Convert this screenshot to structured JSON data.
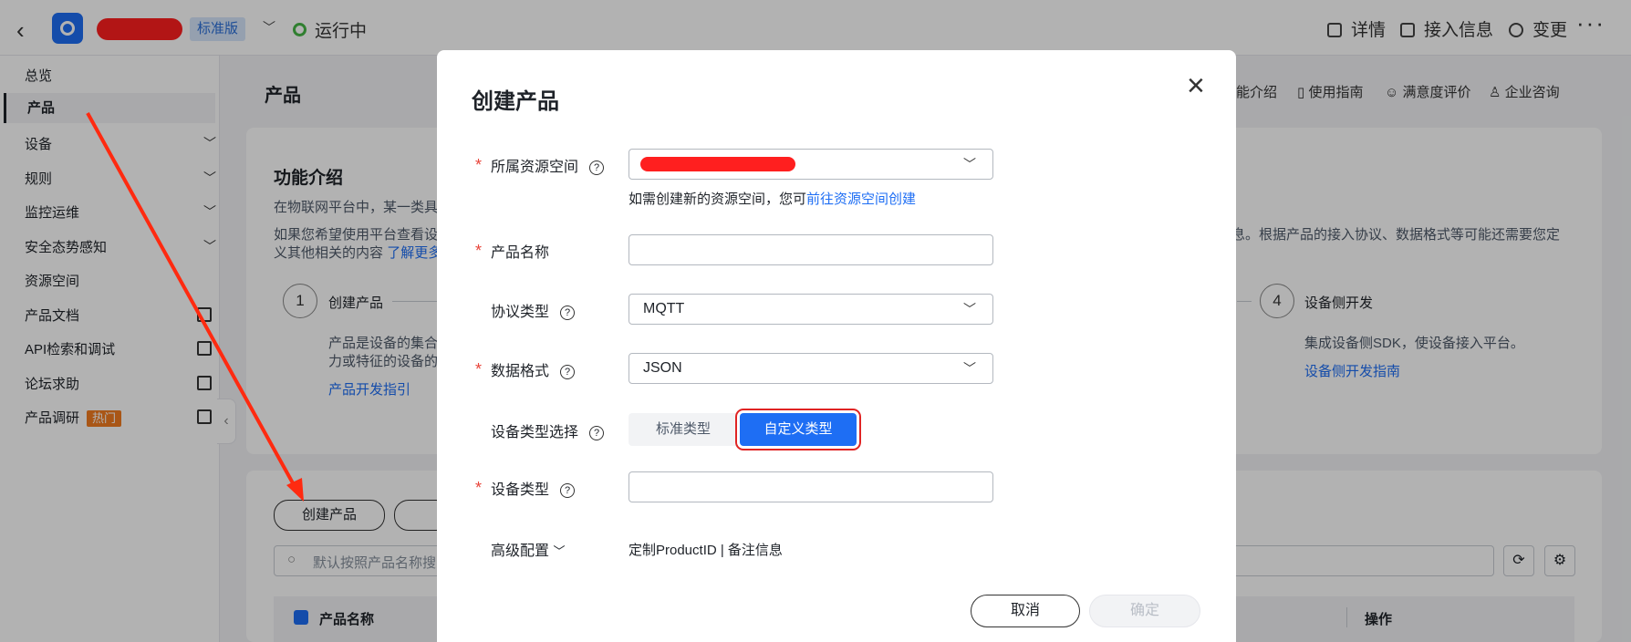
{
  "topbar": {
    "edition": "标准版",
    "status": "运行中",
    "links": [
      "详情",
      "接入信息",
      "变更"
    ],
    "more": "···"
  },
  "sidebar": {
    "items": [
      {
        "label": "总览"
      },
      {
        "label": "产品"
      },
      {
        "label": "设备"
      },
      {
        "label": "规则"
      },
      {
        "label": "监控运维"
      },
      {
        "label": "安全态势感知"
      },
      {
        "label": "资源空间"
      },
      {
        "label": "产品文档"
      },
      {
        "label": "API检索和调试"
      },
      {
        "label": "论坛求助"
      },
      {
        "label": "产品调研"
      }
    ],
    "hot_badge": "热门"
  },
  "main": {
    "title": "产品",
    "header_links": [
      "功能介绍",
      "使用指南",
      "满意度评价",
      "企业咨询"
    ],
    "intro_title": "功能介绍",
    "intro_line1": "在物联网平台中，某一类具",
    "intro_line2": "如果您希望使用平台查看设",
    "intro_line2_right": "息。根据产品的接入协议、数据格式等可能还需要您定",
    "intro_line3": "义其他相关的内容",
    "learn_more": "了解更多",
    "steps": [
      {
        "num": "1",
        "title": "创建产品",
        "desc1": "产品是设备的集合",
        "desc2": "力或特征的设备的",
        "link": "产品开发指引"
      },
      {
        "num": "4",
        "title": "设备侧开发",
        "desc1": "集成设备侧SDK，使设备接入平台。",
        "link": "设备侧开发指南"
      }
    ],
    "create_button": "创建产品",
    "search_placeholder": "默认按照产品名称搜",
    "table_headers": [
      "产品名称",
      "操作"
    ]
  },
  "modal": {
    "title": "创建产品",
    "close": "×",
    "fields": {
      "resource_space": {
        "label": "所属资源空间",
        "required": true
      },
      "resource_hint": "如需创建新的资源空间，您可",
      "resource_hint_link": "前往资源空间创建",
      "product_name": {
        "label": "产品名称",
        "required": true,
        "value": ""
      },
      "protocol": {
        "label": "协议类型",
        "value": "MQTT"
      },
      "data_format": {
        "label": "数据格式",
        "required": true,
        "value": "JSON"
      },
      "device_type_select": {
        "label": "设备类型选择",
        "options": [
          "标准类型",
          "自定义类型"
        ],
        "selected": "自定义类型"
      },
      "device_type": {
        "label": "设备类型",
        "required": true,
        "value": ""
      },
      "advanced": {
        "label": "高级配置",
        "summary": "定制ProductID | 备注信息"
      }
    },
    "cancel_label": "取消",
    "ok_label": "确定"
  },
  "colors": {
    "accent": "#1e6ef4",
    "required": "#e8443a",
    "highlight": "#e02424",
    "hot": "#f27c20",
    "running": "#45b645"
  }
}
